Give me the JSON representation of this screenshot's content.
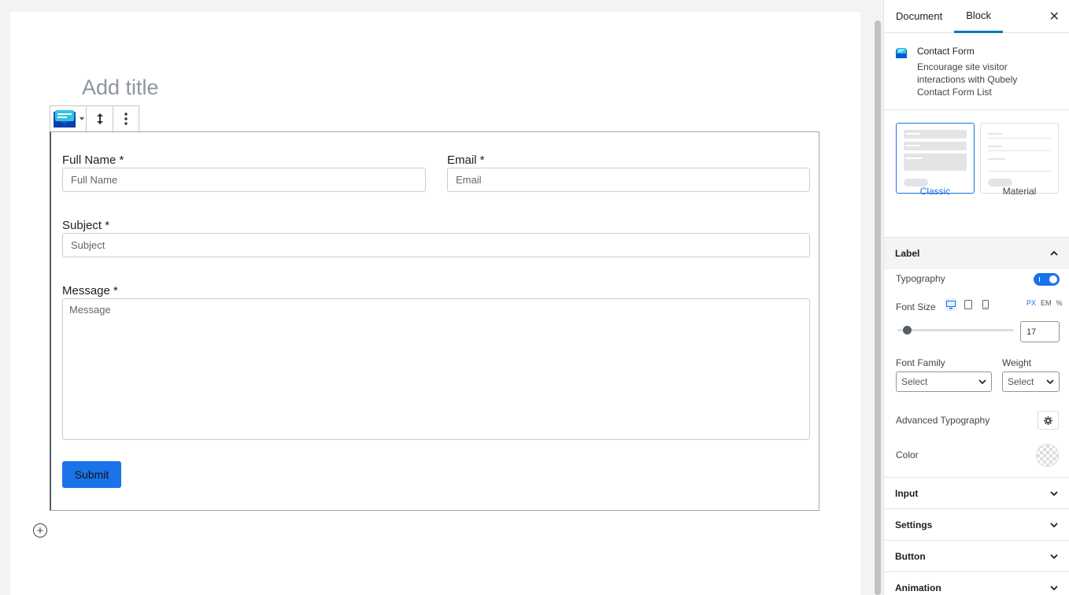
{
  "editor": {
    "title_placeholder": "Add title",
    "add_block_symbol": "+"
  },
  "form": {
    "full_name": {
      "label": "Full Name *",
      "placeholder": "Full Name"
    },
    "email": {
      "label": "Email *",
      "placeholder": "Email"
    },
    "subject": {
      "label": "Subject *",
      "placeholder": "Subject"
    },
    "message": {
      "label": "Message *",
      "placeholder": "Message"
    },
    "submit_label": "Submit"
  },
  "sidebar": {
    "tabs": [
      {
        "label": "Document",
        "active": false
      },
      {
        "label": "Block",
        "active": true
      }
    ],
    "close_symbol": "✕",
    "block_card": {
      "title": "Contact Form",
      "description": "Encourage site visitor interactions with Qubely Contact Form List"
    },
    "styles": [
      {
        "label": "Classic",
        "selected": true
      },
      {
        "label": "Material",
        "selected": false
      }
    ],
    "label_panel": {
      "title": "Label",
      "typography_label": "Typography",
      "typography_on": true,
      "font_size_label": "Font Size",
      "units": [
        "PX",
        "EM",
        "%"
      ],
      "active_unit": "PX",
      "font_size_value": "17",
      "font_family_label": "Font Family",
      "weight_label": "Weight",
      "font_family_value": "Select",
      "weight_value": "Select",
      "advanced_typography_label": "Advanced Typography",
      "color_label": "Color"
    },
    "collapsed_panels": [
      "Input",
      "Settings",
      "Button",
      "Animation"
    ]
  },
  "colors": {
    "accent": "#1a73e8",
    "wp_blue": "#007cba"
  }
}
